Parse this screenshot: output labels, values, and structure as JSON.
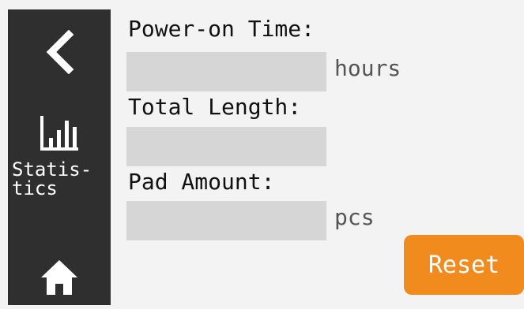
{
  "sidebar": {
    "back_icon": "chevron-left-icon",
    "stats_icon": "bar-chart-icon",
    "stats_label": "Statis-\ntics",
    "home_icon": "home-icon"
  },
  "fields": {
    "power_on_time": {
      "label": "Power-on Time:",
      "value": "",
      "unit": "hours"
    },
    "total_length": {
      "label": "Total Length:",
      "value": ""
    },
    "pad_amount": {
      "label": "Pad Amount:",
      "value": "",
      "unit": "pcs"
    }
  },
  "actions": {
    "reset_label": "Reset"
  },
  "colors": {
    "sidebar_bg": "#2f2f2f",
    "page_bg": "#f3f3f3",
    "field_bg": "#d6d6d6",
    "accent": "#f28b1d"
  }
}
